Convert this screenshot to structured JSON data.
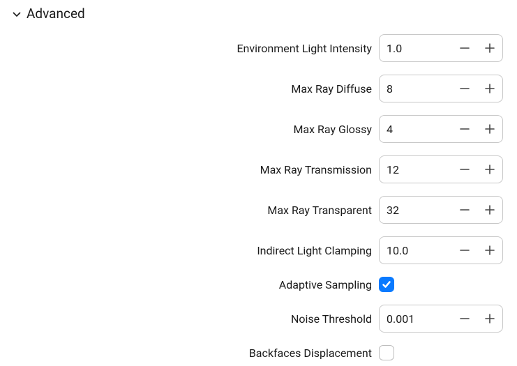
{
  "section": {
    "title": "Advanced",
    "expanded": true
  },
  "fields": {
    "env_light_intensity": {
      "label": "Environment Light Intensity",
      "value": "1.0"
    },
    "max_ray_diffuse": {
      "label": "Max Ray Diffuse",
      "value": "8"
    },
    "max_ray_glossy": {
      "label": "Max Ray Glossy",
      "value": "4"
    },
    "max_ray_transmission": {
      "label": "Max Ray Transmission",
      "value": "12"
    },
    "max_ray_transparent": {
      "label": "Max Ray Transparent",
      "value": "32"
    },
    "indirect_light_clamping": {
      "label": "Indirect Light Clamping",
      "value": "10.0"
    },
    "adaptive_sampling": {
      "label": "Adaptive Sampling",
      "checked": true
    },
    "noise_threshold": {
      "label": "Noise Threshold",
      "value": "0.001"
    },
    "backfaces_displacement": {
      "label": "Backfaces Displacement",
      "checked": false
    }
  }
}
